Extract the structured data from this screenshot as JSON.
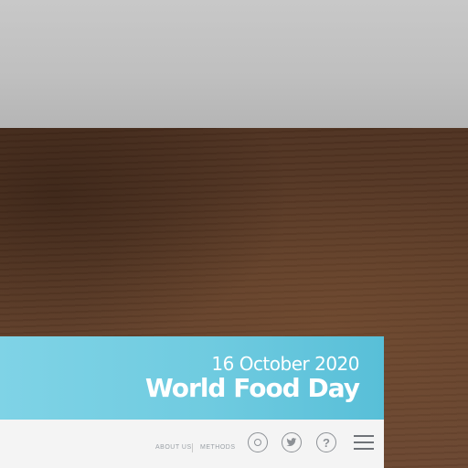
{
  "banner": {
    "date": "16 October 2020",
    "title": "World Food Day"
  },
  "nav": {
    "about_label": "ABOUT US",
    "methods_label": "METHODS"
  },
  "icons": {
    "first": "target-icon",
    "second": "twitter-icon",
    "third": "help-icon",
    "menu": "hamburger-menu-icon",
    "help_glyph": "?"
  },
  "colors": {
    "banner_accent": "#6fcbe0",
    "icon_gray": "#8d9196"
  }
}
